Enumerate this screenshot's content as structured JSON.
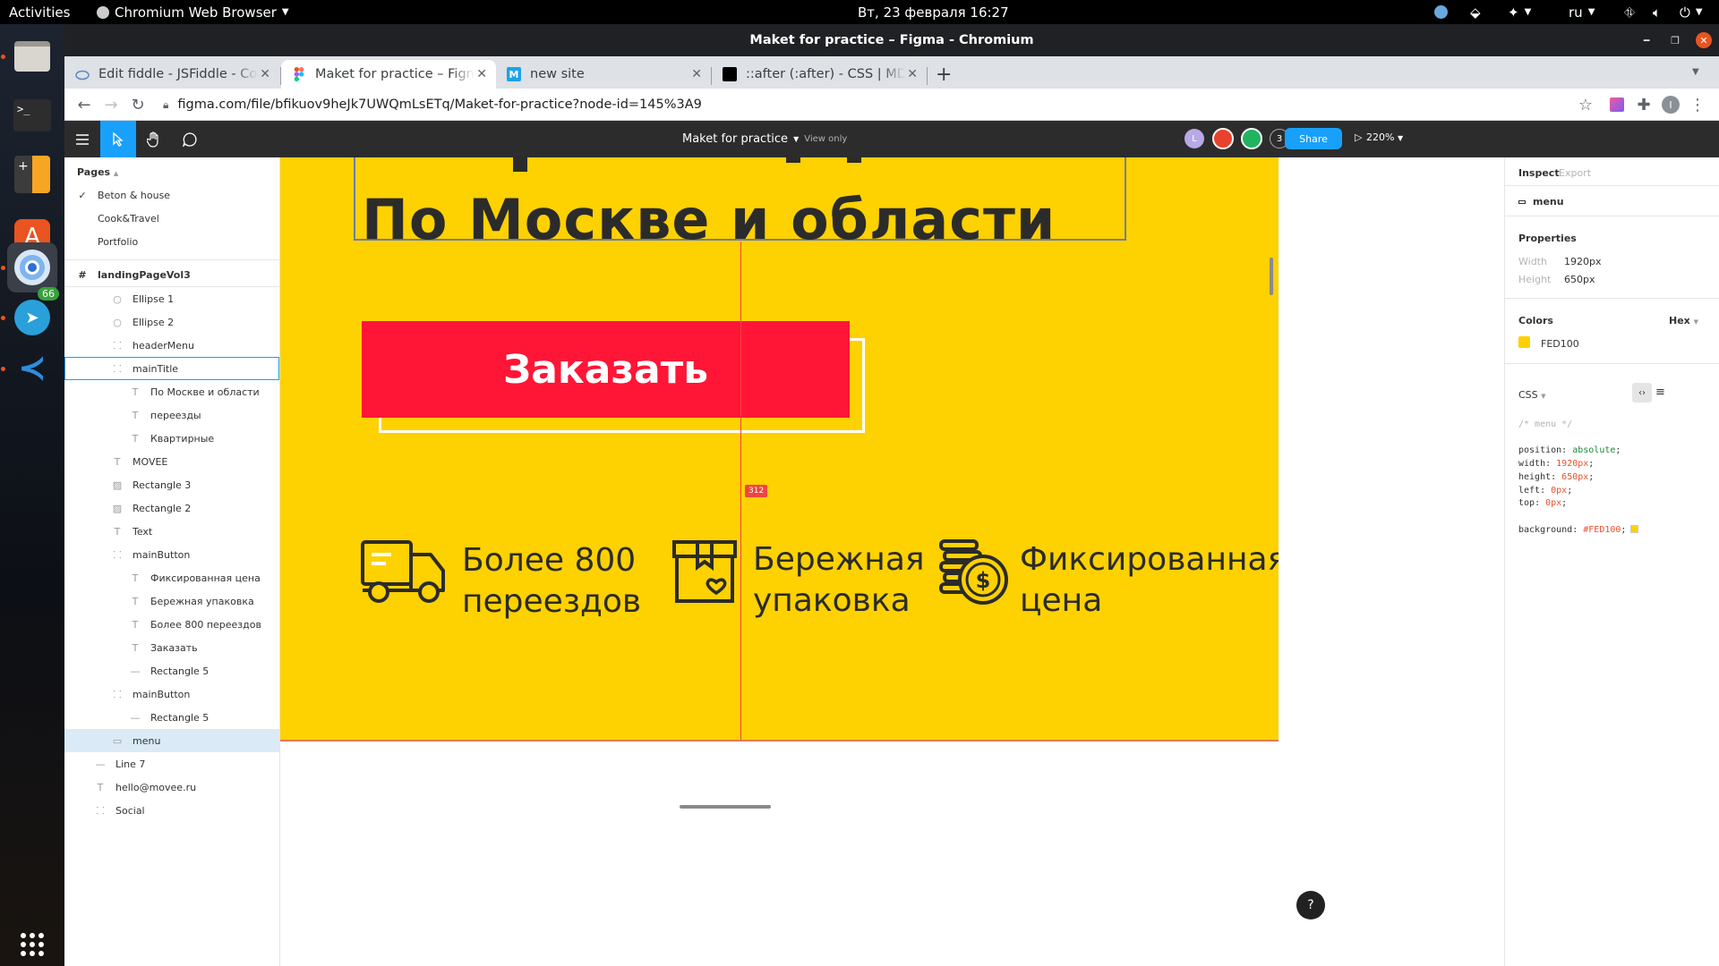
{
  "system": {
    "activities": "Activities",
    "app_name": "Chromium Web Browser",
    "datetime": "Вт, 23 февраля  16:27",
    "language": "ru"
  },
  "dock": {
    "telegram_badge": "66"
  },
  "window": {
    "title": "Maket for practice – Figma - Chromium"
  },
  "tabs": [
    {
      "label": "Edit fiddle - JSFiddle - Code Playground",
      "icon": "jsfiddle-icon"
    },
    {
      "label": "Maket for practice – Figma",
      "icon": "figma-icon"
    },
    {
      "label": "new site",
      "icon": "m-site-icon"
    },
    {
      "label": "::after (:after) - CSS | MDN",
      "icon": "mdn-icon"
    }
  ],
  "address": {
    "url": "figma.com/file/bfikuov9heJk7UWQmLsETq/Maket-for-practice?node-id=145%3A9"
  },
  "figma_toolbar": {
    "file_name": "Maket for practice",
    "mode": "View only",
    "avatar_letter": "L",
    "extra_users": "3",
    "share_label": "Share",
    "zoom": "220%"
  },
  "layers": {
    "pages_heading": "Pages",
    "pages": [
      "Beton & house",
      "Cook&Travel",
      "Portfolio"
    ],
    "items": [
      {
        "label": "landingPageVol3",
        "icon": "frame-hash-icon",
        "depth": 0
      },
      {
        "label": "Ellipse 1",
        "icon": "ellipse-icon",
        "depth": 2
      },
      {
        "label": "Ellipse 2",
        "icon": "ellipse-icon",
        "depth": 2
      },
      {
        "label": "headerMenu",
        "icon": "group-icon",
        "depth": 2
      },
      {
        "label": "mainTitle",
        "icon": "group-icon",
        "depth": 2
      },
      {
        "label": "По Москве и области",
        "icon": "text-icon",
        "depth": 3
      },
      {
        "label": "переезды",
        "icon": "text-icon",
        "depth": 3
      },
      {
        "label": "Квартирные",
        "icon": "text-icon",
        "depth": 3
      },
      {
        "label": "MOVEE",
        "icon": "text-icon",
        "depth": 2
      },
      {
        "label": "Rectangle 3",
        "icon": "image-icon",
        "depth": 2
      },
      {
        "label": "Rectangle 2",
        "icon": "image-icon",
        "depth": 2
      },
      {
        "label": "Text",
        "icon": "text-icon",
        "depth": 2
      },
      {
        "label": "mainButton",
        "icon": "group-icon",
        "depth": 2
      },
      {
        "label": "Фиксированная цена",
        "icon": "text-icon",
        "depth": 3
      },
      {
        "label": "Бережная упаковка",
        "icon": "text-icon",
        "depth": 3
      },
      {
        "label": "Более 800 переездов",
        "icon": "text-icon",
        "depth": 3
      },
      {
        "label": "Заказать",
        "icon": "text-icon",
        "depth": 3
      },
      {
        "label": "Rectangle 5",
        "icon": "line-icon",
        "depth": 3
      },
      {
        "label": "mainButton",
        "icon": "group-icon",
        "depth": 2
      },
      {
        "label": "Rectangle 5",
        "icon": "line-icon",
        "depth": 3
      },
      {
        "label": "menu",
        "icon": "rect-icon",
        "depth": 2
      },
      {
        "label": "Line 7",
        "icon": "line-icon",
        "depth": 1
      },
      {
        "label": "hello@movee.ru",
        "icon": "text-icon",
        "depth": 1
      },
      {
        "label": "Social",
        "icon": "group-icon",
        "depth": 1
      }
    ]
  },
  "canvas": {
    "subtitle": "По Москве и области",
    "button_label": "Заказать",
    "measure": "312",
    "features": [
      {
        "line1": "Более 800",
        "line2": "переездов",
        "icon": "truck-icon"
      },
      {
        "line1": "Бережная",
        "line2": "упаковка",
        "icon": "box-heart-icon"
      },
      {
        "line1": "Фиксированная",
        "line2": "цена",
        "icon": "coins-dollar-icon"
      }
    ]
  },
  "inspect": {
    "tab_inspect": "Inspect",
    "tab_export": "Export",
    "layer_name": "menu",
    "properties_heading": "Properties",
    "width_label": "Width",
    "width_value": "1920px",
    "height_label": "Height",
    "height_value": "650px",
    "colors_heading": "Colors",
    "color_format": "Hex",
    "color_value": "FED100",
    "css_heading": "CSS",
    "code": [
      {
        "t": "/* menu */",
        "k": "comment"
      },
      {
        "t": "",
        "k": "blank"
      },
      {
        "prop": "position",
        "val": "absolute",
        "k": "kw"
      },
      {
        "prop": "width",
        "val": "1920px",
        "k": "num"
      },
      {
        "prop": "height",
        "val": "650px",
        "k": "num"
      },
      {
        "prop": "left",
        "val": "0px",
        "k": "num"
      },
      {
        "prop": "top",
        "val": "0px",
        "k": "num"
      },
      {
        "t": "",
        "k": "blank"
      },
      {
        "prop": "background",
        "val": "#FED100",
        "k": "num"
      }
    ]
  },
  "colors": {
    "brand_yellow": "#FED100",
    "button_red": "#FF1536",
    "figma_blue": "#18a0fb",
    "selection_bg": "#daebf7"
  }
}
